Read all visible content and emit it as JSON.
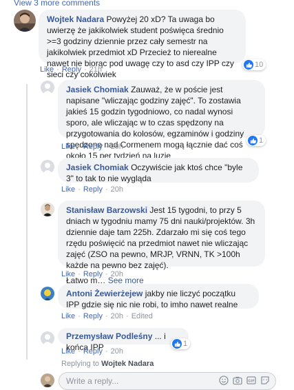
{
  "top_link": "View 3 more comments",
  "comments": [
    {
      "author": "Wojtek Nadara",
      "text": "Powyżej 20 xD? Ta uwaga bo uwierzę że jakikolwiek student poświęca średnio >=3 godziny dziennie przez cały semestr na jakikolwiek przedmiot xD Przecież to nierealne nawet nie biorąc pod uwagę czy to asd czy IPP czy sieci czy cokolwiek",
      "like": "Like",
      "reply": "Reply",
      "time": "21h",
      "reactions": "10"
    },
    {
      "author": "Jasiek Chomiak",
      "text": "Zauważ, że w poście jest napisane \"wliczając godziny zajęć\". To zostawia jakieś 15 godzin tygodniowo, co nadal wynosi sporo, ale wliczając w to czas spędzony na przygotowania do kolosów, egzaminów i godziny spędzone nad Cormenem mogą łącznie dać coś około 15 per tydzień na luzie",
      "like": "Like",
      "reply": "Reply",
      "time": "20h",
      "reactions": "1"
    },
    {
      "author": "Jasiek Chomiak",
      "text": "Oczywiście jak ktoś chce \"byle 3\" to tak to nie wygląda",
      "like": "Like",
      "reply": "Reply",
      "time": "20h"
    },
    {
      "author": "Stanisław Barzowski",
      "text": "Jest 15 tygodni, to przy 5 dniach w tygodniu mamy 75 dni nauki/projektów. 3h dziennie daje tam 225h. Zdarzało mi się coś tego rzędu poświęcić na przedmiot nawet nie wliczając zajęć (ZSO na pewno, MRJP, VRNN, TK >100h każde na pewno bez zajęć).",
      "text2": "Łatwo m…",
      "see_more": "See more",
      "like": "Like",
      "reply": "Reply",
      "time": "20h"
    },
    {
      "author": "Antoni Żewierżejew",
      "text": "jakby nie liczyć początku IPP gdzie się nic nie robi, to imho nawet realne",
      "like": "Like",
      "reply": "Reply",
      "time": "20h",
      "edited": "Edited"
    },
    {
      "author": "Przemysław Podleśny",
      "text": "... i końca IPP",
      "like": "Like",
      "reply": "Reply",
      "time": "20h",
      "reactions": "1"
    }
  ],
  "replying_to": {
    "prefix": "Replying to",
    "name": "Wojtek Nadara"
  },
  "reply_box": {
    "placeholder": "Write a reply..."
  },
  "colors": {
    "link": "#4267b2",
    "name": "#385898",
    "bubble": "#f2f3f5",
    "like_blue": "#2078f4"
  },
  "icons": [
    "thumbs-up-icon",
    "emoji-icon",
    "camera-icon",
    "gif-icon",
    "sticker-icon"
  ]
}
